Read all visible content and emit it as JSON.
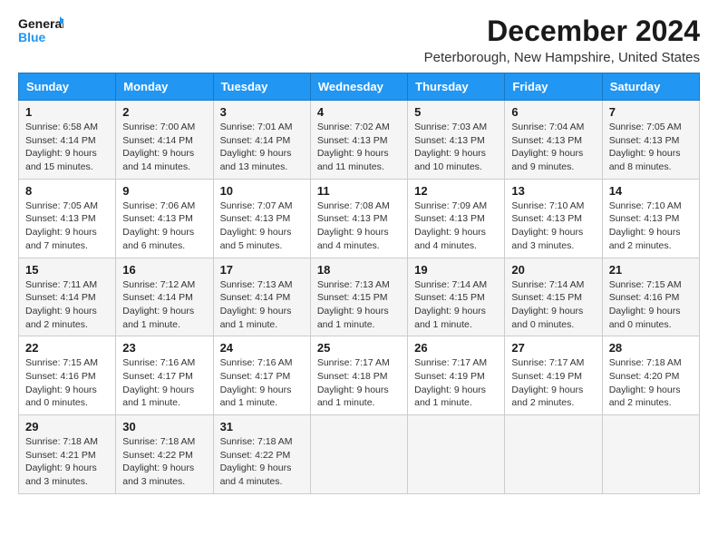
{
  "logo": {
    "text_general": "General",
    "text_blue": "Blue"
  },
  "header": {
    "title": "December 2024",
    "subtitle": "Peterborough, New Hampshire, United States"
  },
  "weekdays": [
    "Sunday",
    "Monday",
    "Tuesday",
    "Wednesday",
    "Thursday",
    "Friday",
    "Saturday"
  ],
  "weeks": [
    [
      {
        "day": "1",
        "sunrise": "6:58 AM",
        "sunset": "4:14 PM",
        "daylight": "9 hours and 15 minutes."
      },
      {
        "day": "2",
        "sunrise": "7:00 AM",
        "sunset": "4:14 PM",
        "daylight": "9 hours and 14 minutes."
      },
      {
        "day": "3",
        "sunrise": "7:01 AM",
        "sunset": "4:14 PM",
        "daylight": "9 hours and 13 minutes."
      },
      {
        "day": "4",
        "sunrise": "7:02 AM",
        "sunset": "4:13 PM",
        "daylight": "9 hours and 11 minutes."
      },
      {
        "day": "5",
        "sunrise": "7:03 AM",
        "sunset": "4:13 PM",
        "daylight": "9 hours and 10 minutes."
      },
      {
        "day": "6",
        "sunrise": "7:04 AM",
        "sunset": "4:13 PM",
        "daylight": "9 hours and 9 minutes."
      },
      {
        "day": "7",
        "sunrise": "7:05 AM",
        "sunset": "4:13 PM",
        "daylight": "9 hours and 8 minutes."
      }
    ],
    [
      {
        "day": "8",
        "sunrise": "7:05 AM",
        "sunset": "4:13 PM",
        "daylight": "9 hours and 7 minutes."
      },
      {
        "day": "9",
        "sunrise": "7:06 AM",
        "sunset": "4:13 PM",
        "daylight": "9 hours and 6 minutes."
      },
      {
        "day": "10",
        "sunrise": "7:07 AM",
        "sunset": "4:13 PM",
        "daylight": "9 hours and 5 minutes."
      },
      {
        "day": "11",
        "sunrise": "7:08 AM",
        "sunset": "4:13 PM",
        "daylight": "9 hours and 4 minutes."
      },
      {
        "day": "12",
        "sunrise": "7:09 AM",
        "sunset": "4:13 PM",
        "daylight": "9 hours and 4 minutes."
      },
      {
        "day": "13",
        "sunrise": "7:10 AM",
        "sunset": "4:13 PM",
        "daylight": "9 hours and 3 minutes."
      },
      {
        "day": "14",
        "sunrise": "7:10 AM",
        "sunset": "4:13 PM",
        "daylight": "9 hours and 2 minutes."
      }
    ],
    [
      {
        "day": "15",
        "sunrise": "7:11 AM",
        "sunset": "4:14 PM",
        "daylight": "9 hours and 2 minutes."
      },
      {
        "day": "16",
        "sunrise": "7:12 AM",
        "sunset": "4:14 PM",
        "daylight": "9 hours and 1 minute."
      },
      {
        "day": "17",
        "sunrise": "7:13 AM",
        "sunset": "4:14 PM",
        "daylight": "9 hours and 1 minute."
      },
      {
        "day": "18",
        "sunrise": "7:13 AM",
        "sunset": "4:15 PM",
        "daylight": "9 hours and 1 minute."
      },
      {
        "day": "19",
        "sunrise": "7:14 AM",
        "sunset": "4:15 PM",
        "daylight": "9 hours and 1 minute."
      },
      {
        "day": "20",
        "sunrise": "7:14 AM",
        "sunset": "4:15 PM",
        "daylight": "9 hours and 0 minutes."
      },
      {
        "day": "21",
        "sunrise": "7:15 AM",
        "sunset": "4:16 PM",
        "daylight": "9 hours and 0 minutes."
      }
    ],
    [
      {
        "day": "22",
        "sunrise": "7:15 AM",
        "sunset": "4:16 PM",
        "daylight": "9 hours and 0 minutes."
      },
      {
        "day": "23",
        "sunrise": "7:16 AM",
        "sunset": "4:17 PM",
        "daylight": "9 hours and 1 minute."
      },
      {
        "day": "24",
        "sunrise": "7:16 AM",
        "sunset": "4:17 PM",
        "daylight": "9 hours and 1 minute."
      },
      {
        "day": "25",
        "sunrise": "7:17 AM",
        "sunset": "4:18 PM",
        "daylight": "9 hours and 1 minute."
      },
      {
        "day": "26",
        "sunrise": "7:17 AM",
        "sunset": "4:19 PM",
        "daylight": "9 hours and 1 minute."
      },
      {
        "day": "27",
        "sunrise": "7:17 AM",
        "sunset": "4:19 PM",
        "daylight": "9 hours and 2 minutes."
      },
      {
        "day": "28",
        "sunrise": "7:18 AM",
        "sunset": "4:20 PM",
        "daylight": "9 hours and 2 minutes."
      }
    ],
    [
      {
        "day": "29",
        "sunrise": "7:18 AM",
        "sunset": "4:21 PM",
        "daylight": "9 hours and 3 minutes."
      },
      {
        "day": "30",
        "sunrise": "7:18 AM",
        "sunset": "4:22 PM",
        "daylight": "9 hours and 3 minutes."
      },
      {
        "day": "31",
        "sunrise": "7:18 AM",
        "sunset": "4:22 PM",
        "daylight": "9 hours and 4 minutes."
      },
      null,
      null,
      null,
      null
    ]
  ],
  "labels": {
    "sunrise": "Sunrise:",
    "sunset": "Sunset:",
    "daylight": "Daylight:"
  }
}
